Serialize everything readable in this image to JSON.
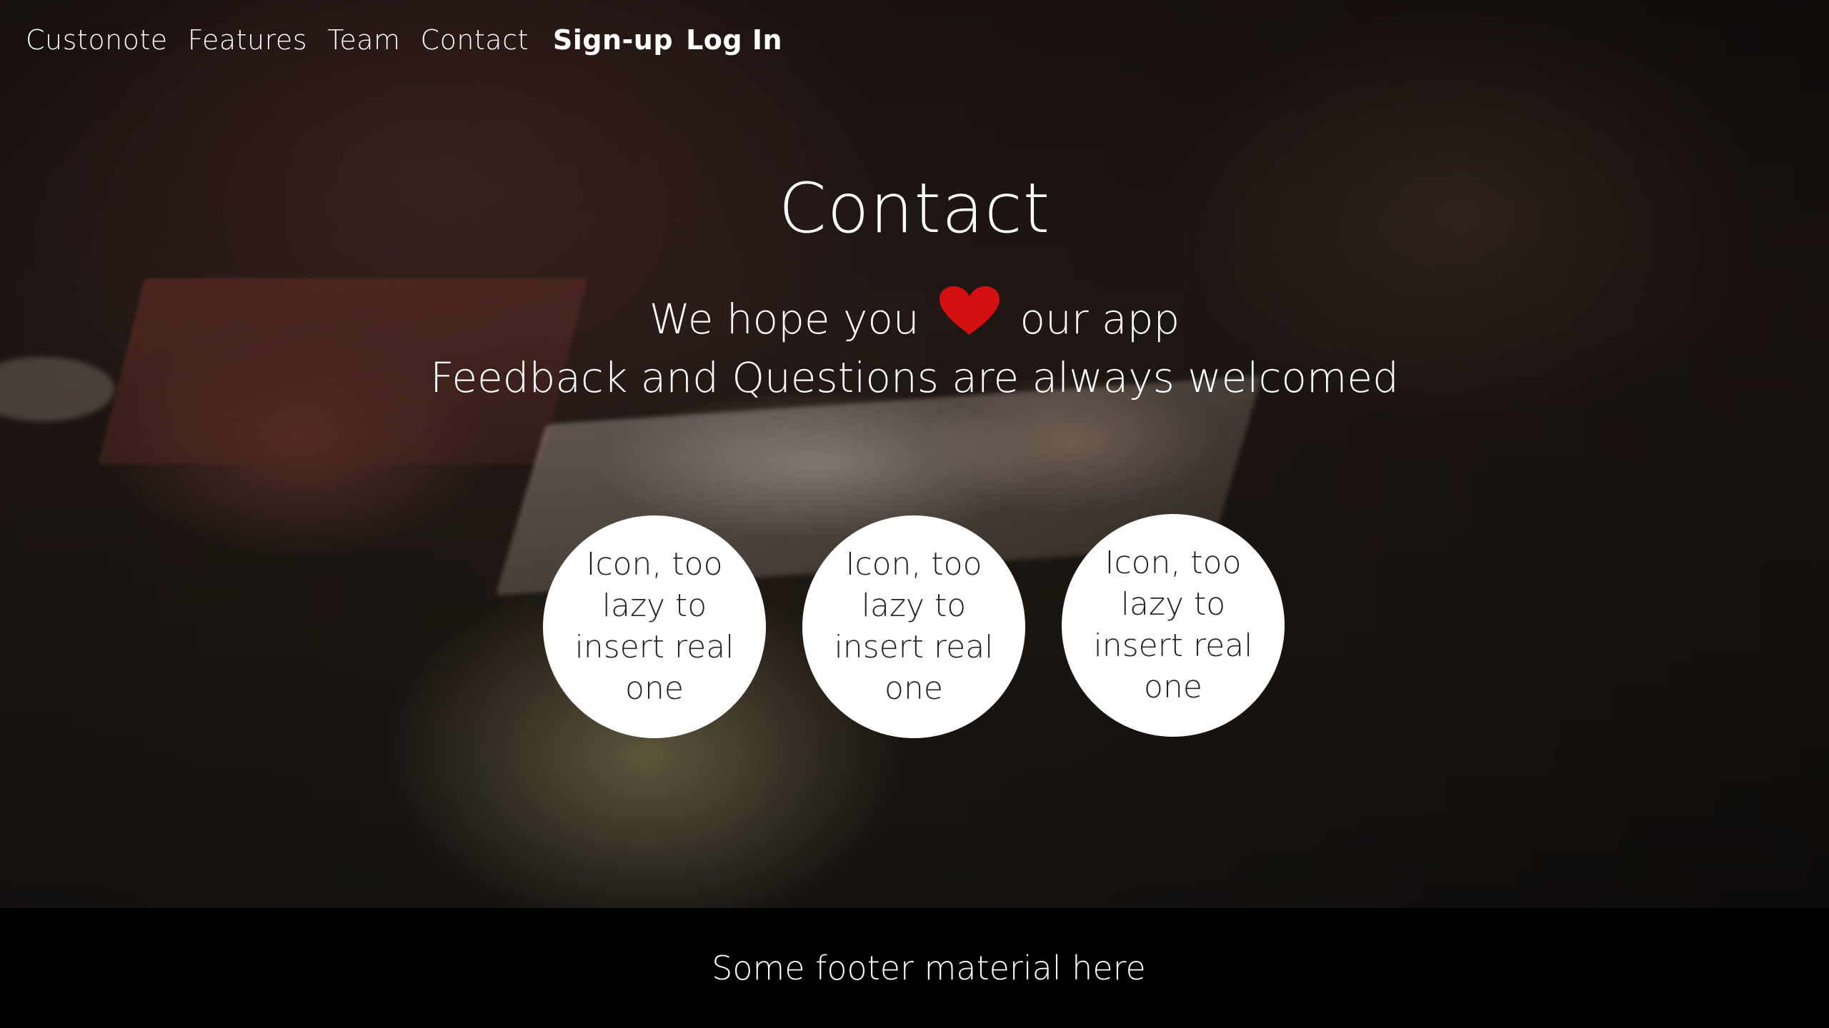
{
  "nav": {
    "brand": "Custonote",
    "links": [
      "Features",
      "Team",
      "Contact"
    ],
    "signup": "Sign-up",
    "login": "Log In"
  },
  "page": {
    "title": "Contact",
    "tagline_prefix": "We hope you",
    "tagline_suffix": "our app",
    "tagline_line2": "Feedback and Questions are always welcomed"
  },
  "circles": [
    {
      "label": "Icon, too lazy to insert real one"
    },
    {
      "label": "Icon, too lazy to insert real one"
    },
    {
      "label": "Icon, too lazy to insert real one"
    }
  ],
  "footer": {
    "text": "Some footer material here"
  },
  "colors": {
    "heart": "#d40f0f",
    "footer_bg": "#000000",
    "circle_bg": "#ffffff"
  },
  "icons": {
    "heart": "heart-icon"
  }
}
